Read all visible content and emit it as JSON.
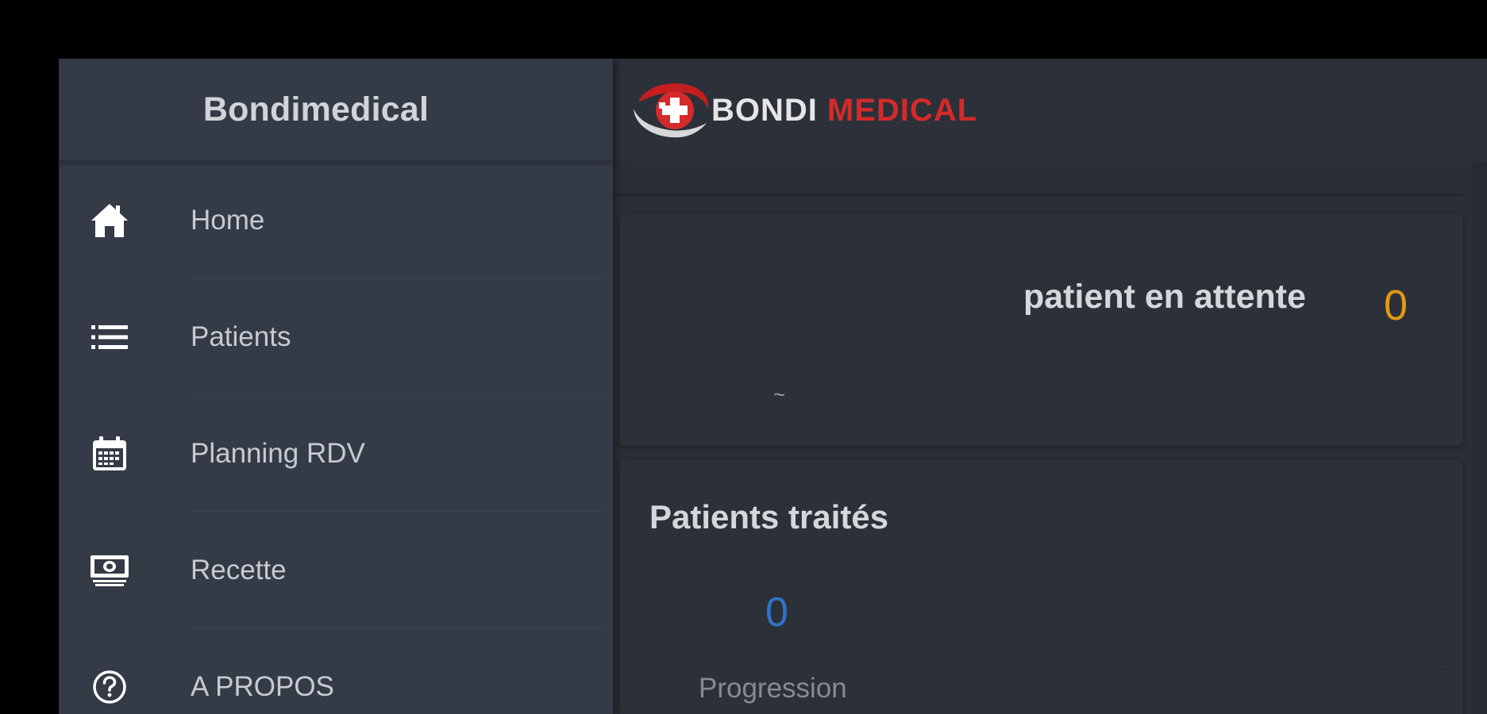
{
  "sidebar": {
    "brand": "Bondimedical",
    "items": [
      {
        "label": "Home",
        "icon": "home-icon"
      },
      {
        "label": "Patients",
        "icon": "list-icon"
      },
      {
        "label": "Planning RDV",
        "icon": "calendar-icon"
      },
      {
        "label": "Recette",
        "icon": "money-icon"
      },
      {
        "label": "A PROPOS",
        "icon": "help-circle-icon"
      }
    ]
  },
  "header": {
    "logo_text_first": "BONDI",
    "logo_text_second": "MEDICAL"
  },
  "waiting_card": {
    "label": "patient en attente",
    "count": "0",
    "footer": "~"
  },
  "treated_card": {
    "title": "Patients traités",
    "count": "0",
    "progress_label": "Progression"
  },
  "colors": {
    "background": "#000000",
    "sidebar": "#343a46",
    "main": "#2a2e37",
    "waiting_count": "#e09a12",
    "treated_count": "#2f74c9",
    "logo_red": "#d42a2a"
  }
}
